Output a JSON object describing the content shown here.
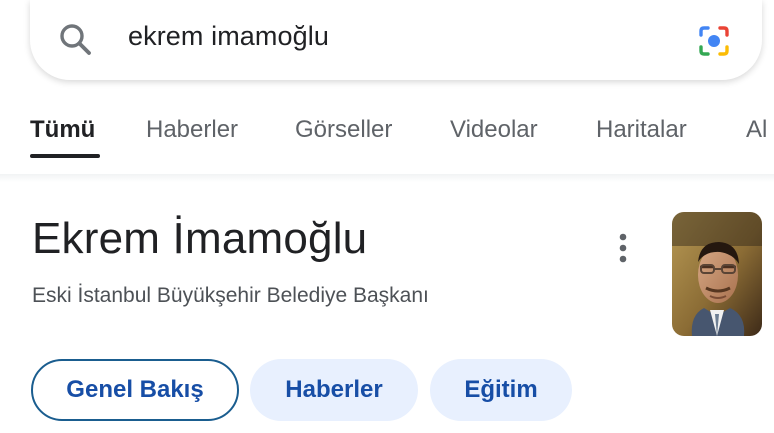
{
  "search": {
    "query": "ekrem imamoğlu",
    "icons": [
      "search-icon",
      "camera-icon"
    ]
  },
  "tabs": [
    {
      "label": "Tümü",
      "active": true
    },
    {
      "label": "Haberler",
      "active": false
    },
    {
      "label": "Görseller",
      "active": false
    },
    {
      "label": "Videolar",
      "active": false
    },
    {
      "label": "Haritalar",
      "active": false
    },
    {
      "label": "Al",
      "active": false
    }
  ],
  "knowledge_panel": {
    "title": "Ekrem İmamoğlu",
    "subtitle": "Eski İstanbul Büyükşehir Belediye Başkanı",
    "more_icon": "more-vert-icon",
    "chips": [
      {
        "label": "Genel Bakış",
        "selected": true
      },
      {
        "label": "Haberler",
        "selected": false
      },
      {
        "label": "Eğitim",
        "selected": false
      }
    ]
  },
  "colors": {
    "chip_background": "#e8f0fe",
    "chip_text": "#174ea6",
    "selected_chip_border": "#1a5d8f"
  }
}
